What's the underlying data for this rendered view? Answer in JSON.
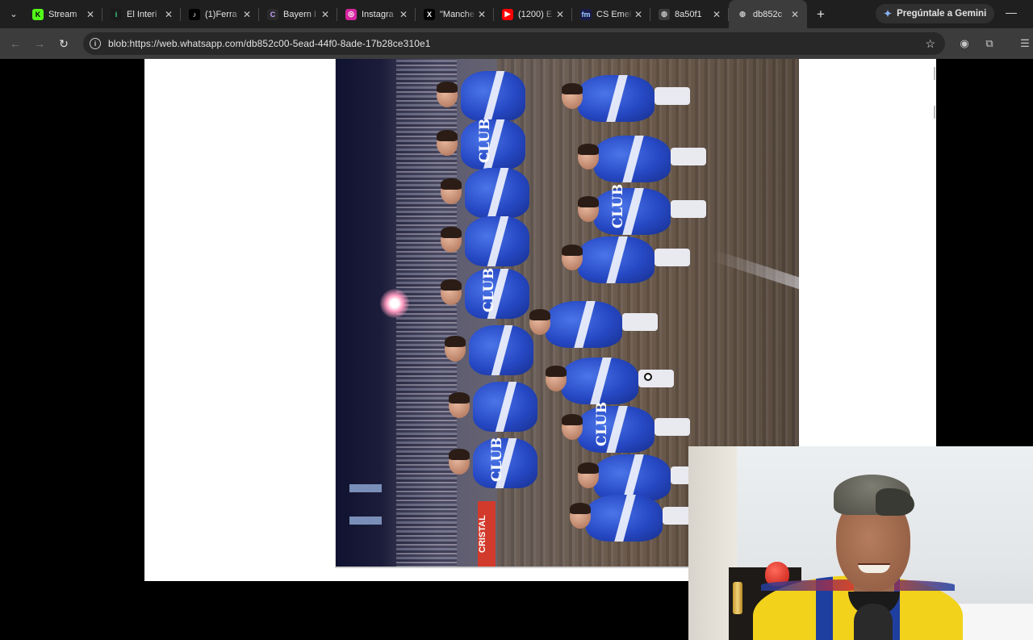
{
  "tabs": [
    {
      "title": "Stream",
      "icon": "kick-icon",
      "color": "#53fc18",
      "glyph": "K",
      "fg": "#000"
    },
    {
      "title": "El Interi",
      "icon": "interia-icon",
      "color": "#1a1a1a",
      "glyph": "i",
      "fg": "#3ddc84"
    },
    {
      "title": "(1)Ferra",
      "icon": "tiktok-icon",
      "color": "#000000",
      "glyph": "♪",
      "fg": "#fff"
    },
    {
      "title": "Bayern I",
      "icon": "bayern-icon",
      "color": "#2b2b2b",
      "glyph": "C",
      "fg": "#c7a3ff"
    },
    {
      "title": "Instagra",
      "icon": "instagram-icon",
      "color": "#d6249f",
      "glyph": "◎",
      "fg": "#fff"
    },
    {
      "title": "\"Manche",
      "icon": "x-icon",
      "color": "#000000",
      "glyph": "X",
      "fg": "#fff"
    },
    {
      "title": "(1200) E",
      "icon": "youtube-icon",
      "color": "#ff0000",
      "glyph": "▶",
      "fg": "#fff"
    },
    {
      "title": "CS Emel",
      "icon": "fm-icon",
      "color": "#1a1a4a",
      "glyph": "fm",
      "fg": "#9ad1ff"
    },
    {
      "title": "8a50f1",
      "icon": "globe-icon",
      "color": "#3c3c3c",
      "glyph": "◍",
      "fg": "#c8c8c8"
    },
    {
      "title": "db852c",
      "icon": "globe-icon",
      "color": "#3c3c3c",
      "glyph": "◍",
      "fg": "#c8c8c8",
      "active": true
    }
  ],
  "gemini_label": "Pregúntale a Gemini",
  "address": {
    "url": "blob:https://web.whatsapp.com/db852c00-5ead-44f0-8ade-17b28ce310e1"
  },
  "photo": {
    "club_label": "CLUB",
    "ad_label": "CRISTAL"
  },
  "colors": {
    "chrome_dark": "#1f1f1f",
    "chrome_toolbar": "#3c3c3c",
    "page_bg": "#ffffff",
    "jersey_blue": "#2648c4",
    "webcam_jersey_yellow": "#f2d21b"
  }
}
